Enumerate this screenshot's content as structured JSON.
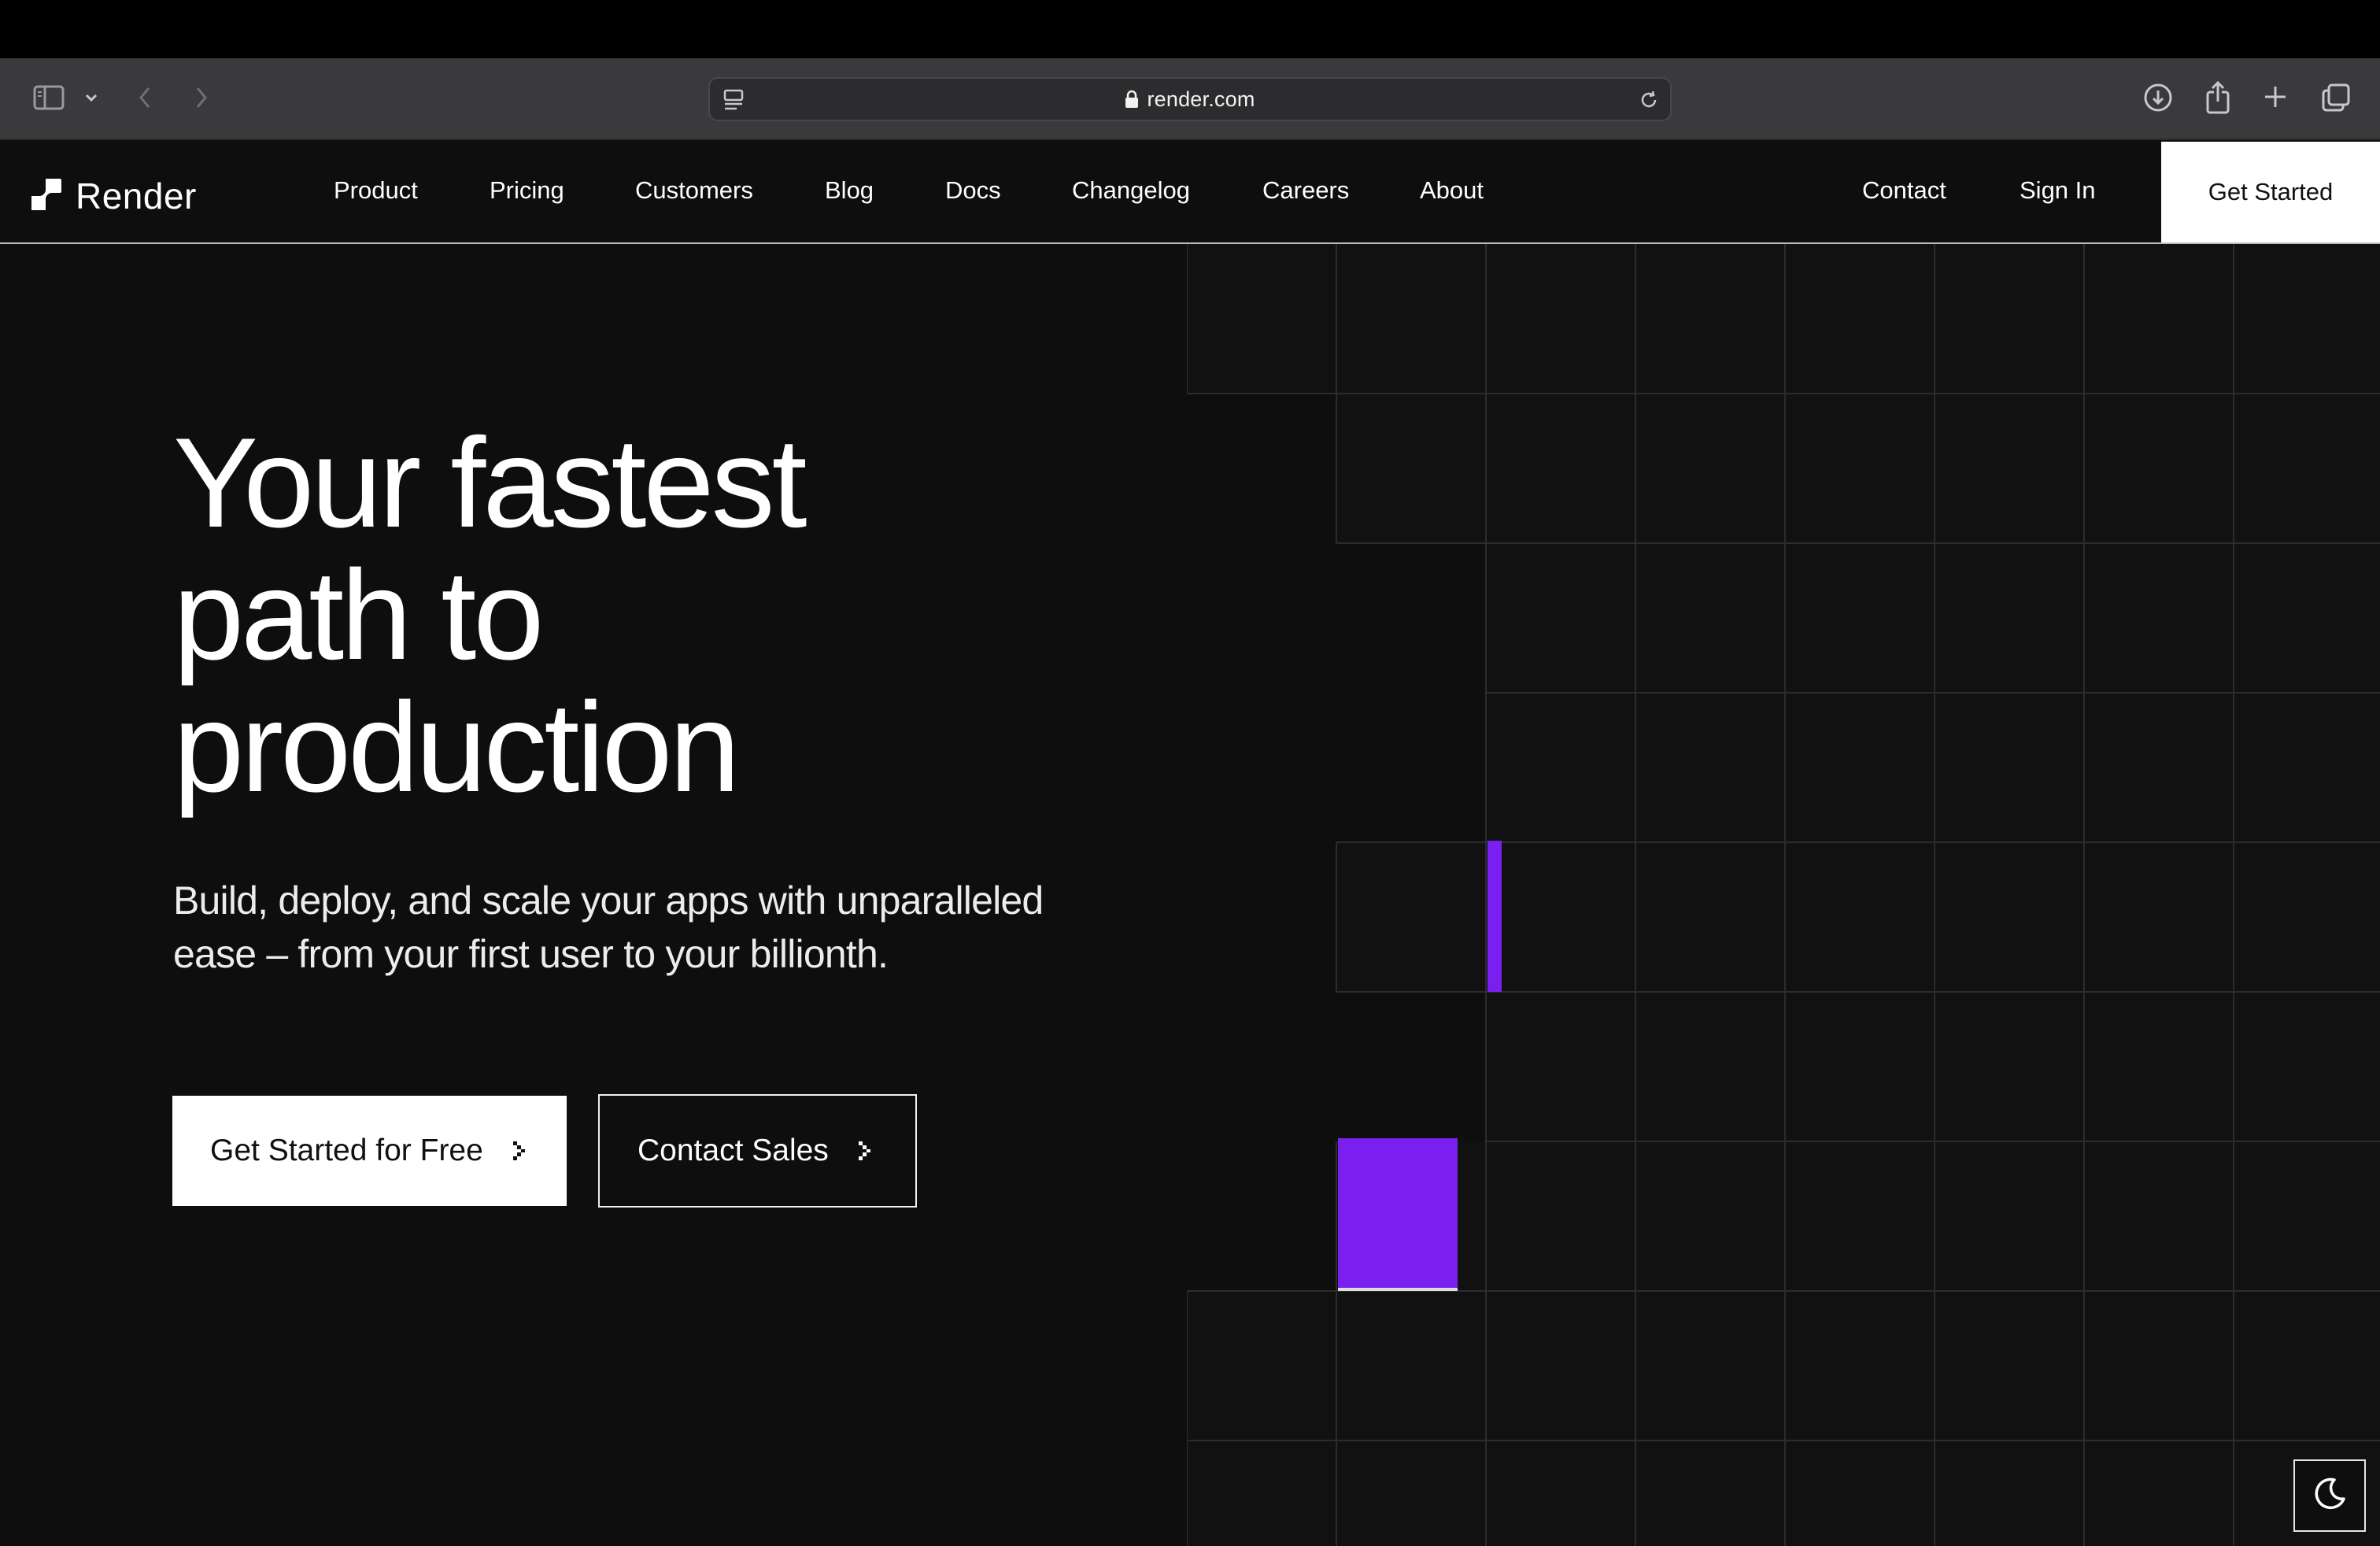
{
  "browser": {
    "url": "render.com",
    "icons": [
      "sidebar-icon",
      "chevron-down-icon",
      "back-icon",
      "forward-icon",
      "reader-icon",
      "lock-icon",
      "reload-icon",
      "download-icon",
      "share-icon",
      "new-tab-icon",
      "tabs-overview-icon"
    ]
  },
  "header": {
    "logo_text": "Render",
    "nav": [
      "Product",
      "Pricing",
      "Customers",
      "Blog",
      "Docs",
      "Changelog",
      "Careers",
      "About"
    ],
    "contact": "Contact",
    "sign_in": "Sign In",
    "get_started": "Get Started"
  },
  "hero": {
    "title_lines": [
      "Your fastest",
      "path to",
      "production"
    ],
    "subtitle_lines": [
      "Build, deploy, and scale your apps with unparalleled",
      "ease – from your first user to your billionth."
    ],
    "primary_cta": "Get Started for Free",
    "secondary_cta": "Contact Sales"
  },
  "colors": {
    "background": "#0e0e0e",
    "accent": "#7b1ff0",
    "button_bg": "#ffffff",
    "grid_line": "#2a2a2a"
  },
  "theme_toggle": {
    "icon": "moon-icon"
  }
}
